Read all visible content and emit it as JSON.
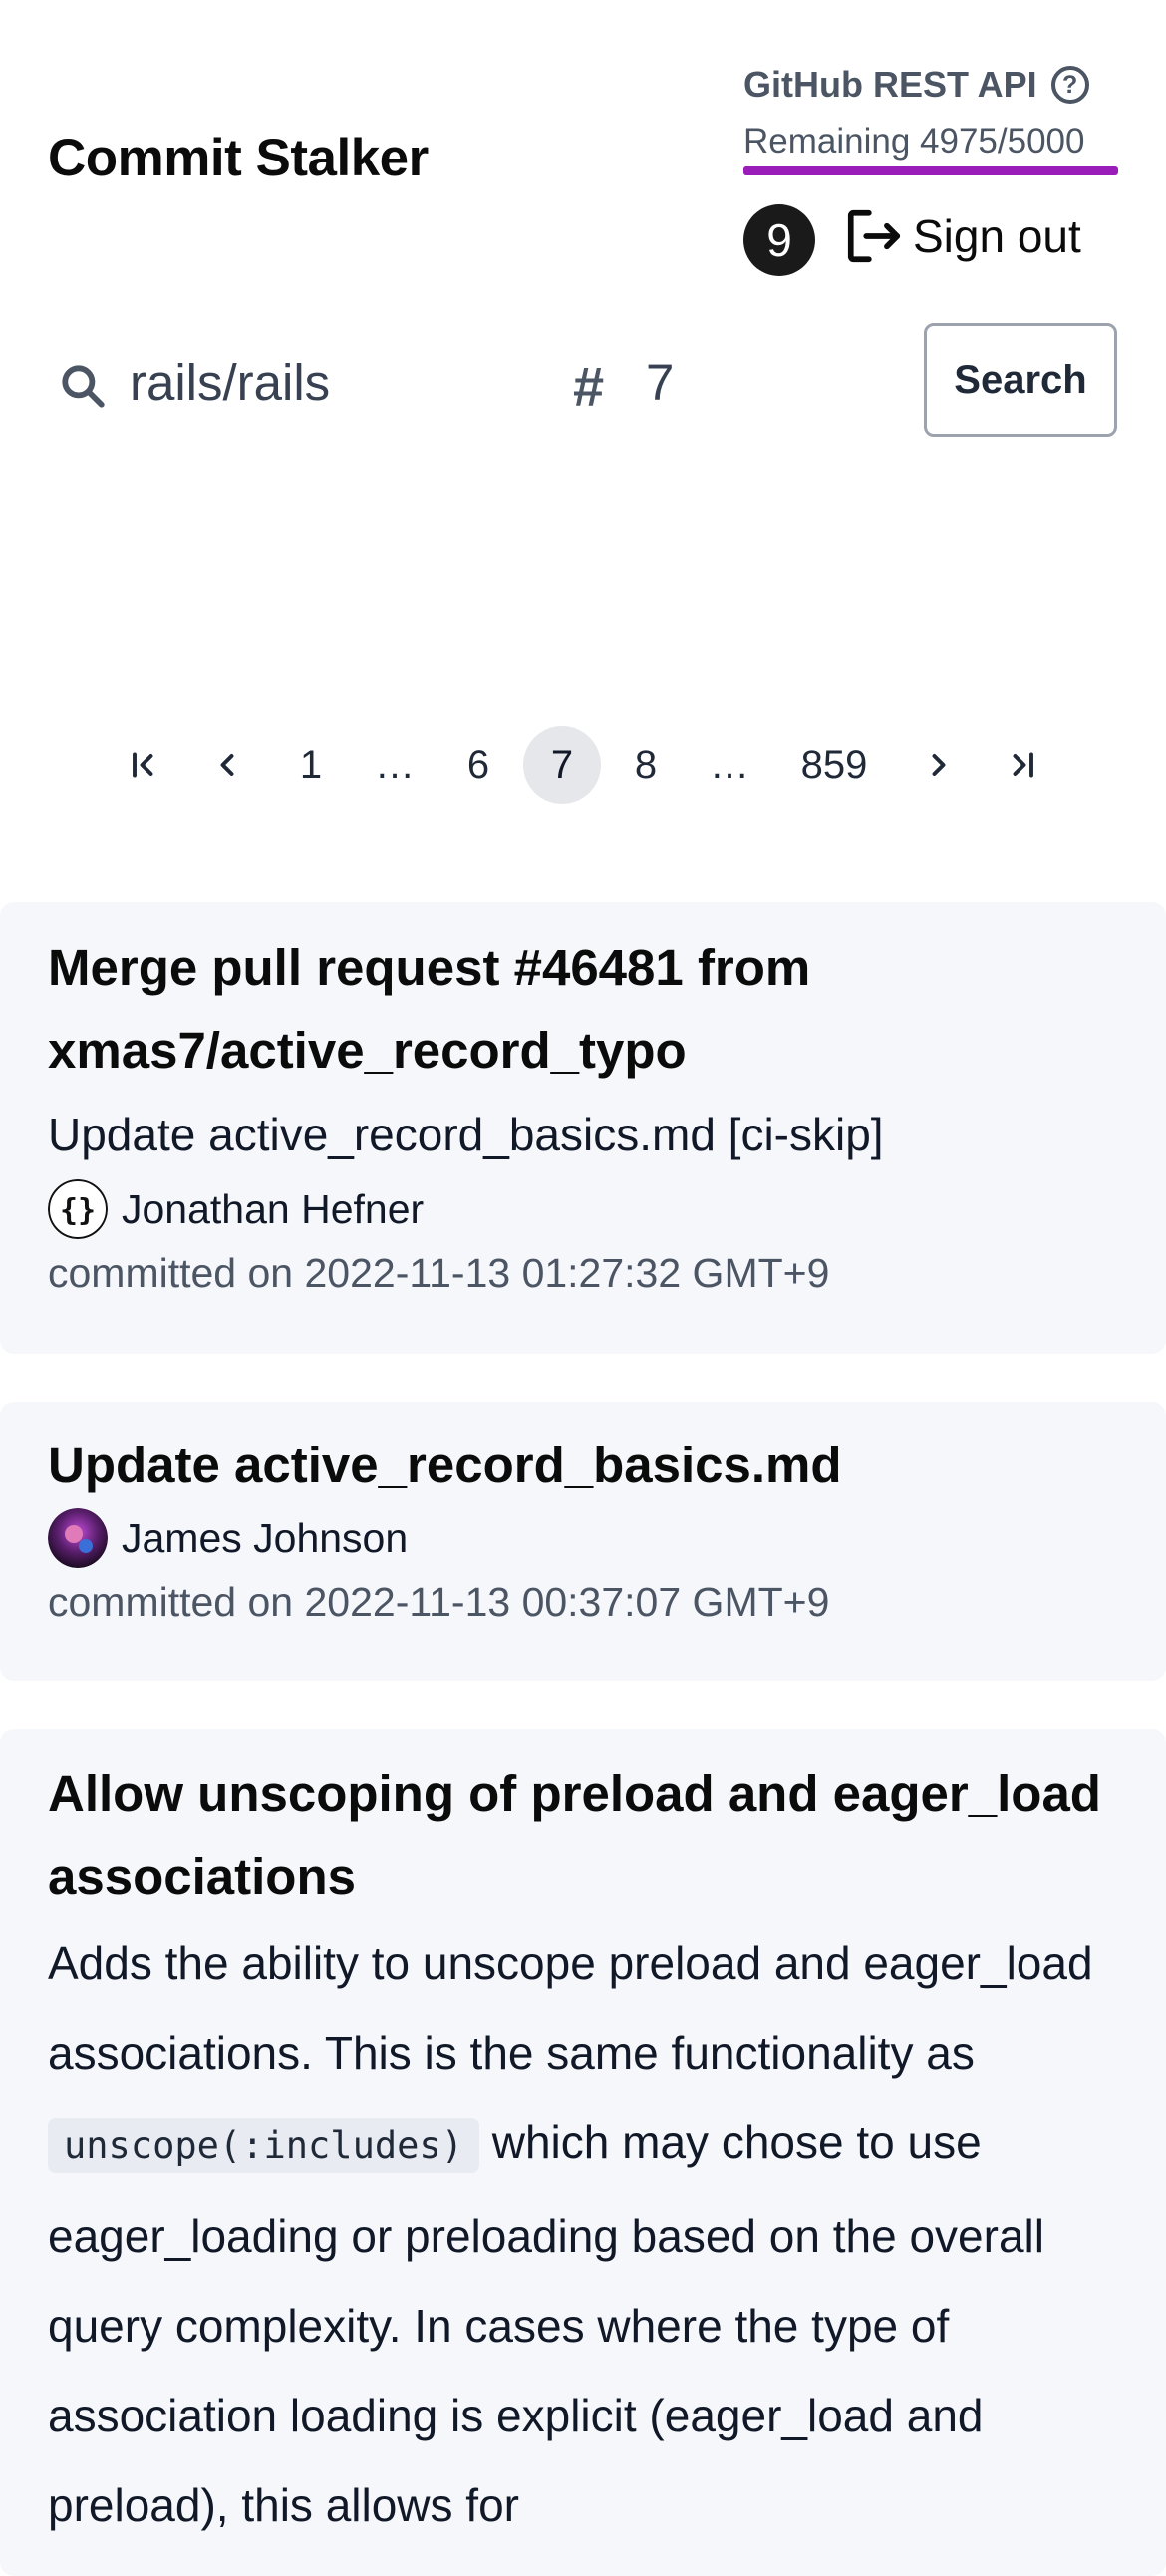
{
  "app": {
    "title": "Commit Stalker"
  },
  "api": {
    "label": "GitHub REST API",
    "help_icon": "question-circle-icon",
    "remaining_text": "Remaining 4975/5000",
    "remaining_fraction": 0.995,
    "bar_color": "#9b1db9"
  },
  "user": {
    "badge": "9",
    "signout_label": "Sign out"
  },
  "search": {
    "repo_value": "rails/rails",
    "page_value": "7",
    "hash_symbol": "#",
    "button_label": "Search"
  },
  "pagination": {
    "first_icon": "first-page-icon",
    "prev_icon": "chevron-left-icon",
    "next_icon": "chevron-right-icon",
    "last_icon": "last-page-icon",
    "pages": [
      "1",
      "…",
      "6",
      "7",
      "8",
      "…",
      "859"
    ],
    "current": "7"
  },
  "commits": [
    {
      "title": "Merge pull request #46481 from xmas7/active_record_typo",
      "message": "Update active_record_basics.md [ci-skip]",
      "author": "Jonathan Hefner",
      "committed": "committed on 2022-11-13 01:27:32 GMT+9"
    },
    {
      "title": "Update active_record_basics.md",
      "author": "James Johnson",
      "committed": "committed on 2022-11-13 00:37:07 GMT+9"
    },
    {
      "title": "Allow unscoping of preload and eager_load associations",
      "message_before": "Adds the ability to unscope preload and eager_load associations. This is the same functionality as",
      "message_code": "unscope(:includes)",
      "message_after": "which may chose to use eager_loading or preloading based on the overall query complexity. In cases where the type of association loading is explicit (eager_load and preload), this allows for"
    }
  ],
  "colors": {
    "accent": "#9b1db9",
    "card_bg": "#f5f7fb",
    "muted_text": "#4b5563"
  }
}
